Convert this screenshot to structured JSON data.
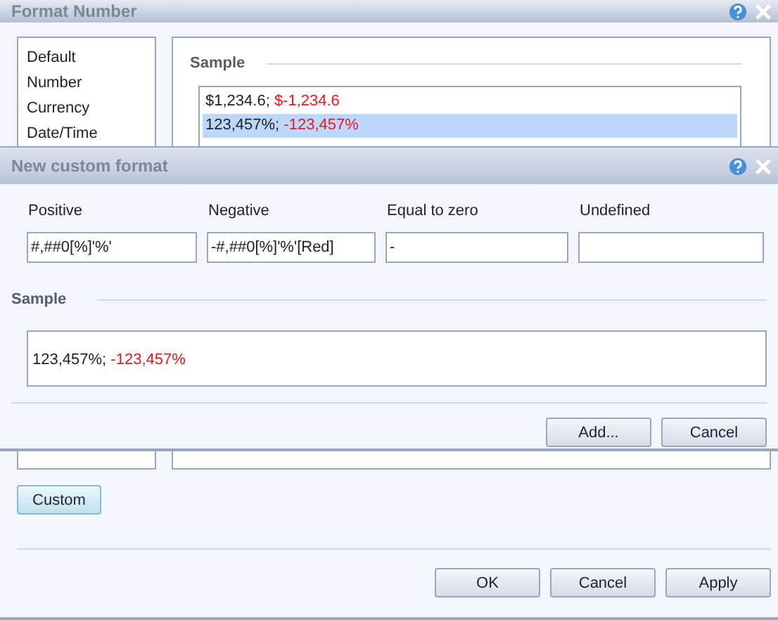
{
  "window": {
    "title": "Format Number"
  },
  "categories": [
    "Default",
    "Number",
    "Currency",
    "Date/Time"
  ],
  "sample_heading": "Sample",
  "sample_list": [
    {
      "positive": "$1,234.6;",
      "negative": "$-1,234.6",
      "selected": false
    },
    {
      "positive": "123,457%;",
      "negative": "-123,457%",
      "selected": true
    }
  ],
  "custom_button": "Custom",
  "buttons": [
    "OK",
    "Cancel",
    "Apply"
  ],
  "custom_dialog": {
    "title": "New custom format",
    "fields": [
      {
        "label": "Positive",
        "value": "#,##0[%]'%'"
      },
      {
        "label": "Negative",
        "value": "-#,##0[%]'%'[Red]"
      },
      {
        "label": "Equal to zero",
        "value": "-"
      },
      {
        "label": "Undefined"
      }
    ],
    "sample_heading": "Sample",
    "sample": {
      "positive": "123,457%;",
      "negative": "-123,457%"
    },
    "buttons": [
      "Add...",
      "Cancel"
    ]
  }
}
